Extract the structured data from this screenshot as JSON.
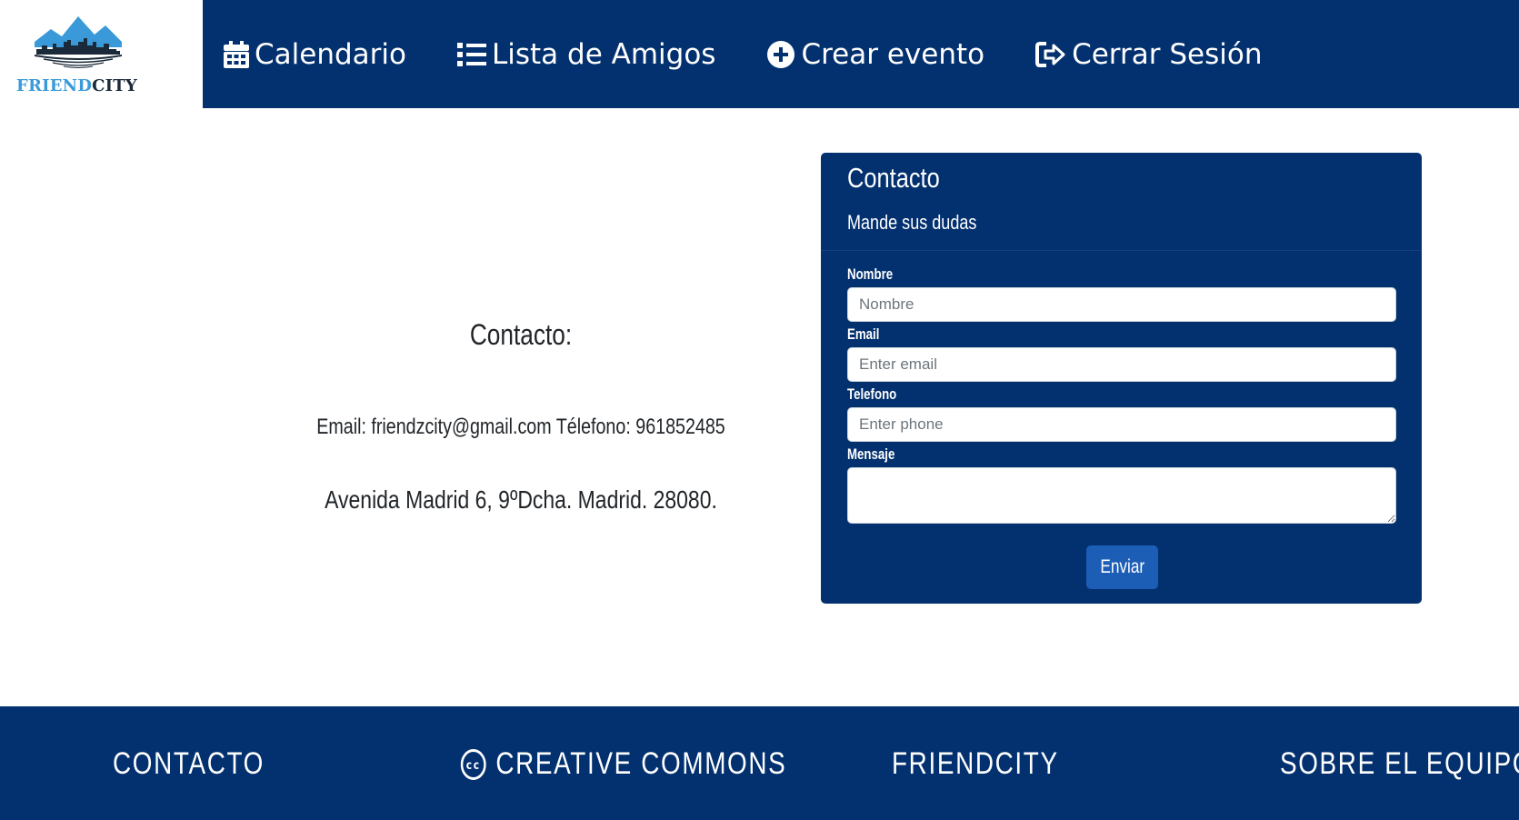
{
  "logo": {
    "part1": "FRIEND",
    "part2": "CITY"
  },
  "nav": [
    {
      "label": "Calendario",
      "icon": "calendar-icon"
    },
    {
      "label": "Lista de Amigos",
      "icon": "list-icon"
    },
    {
      "label": "Crear evento",
      "icon": "plus-circle-icon"
    },
    {
      "label": "Cerrar Sesión",
      "icon": "sign-out-icon"
    }
  ],
  "contact_info": {
    "title": "Contacto:",
    "email_phone": "Email: friendzcity@gmail.com Télefono: 961852485",
    "address": "Avenida Madrid 6, 9ºDcha. Madrid. 28080."
  },
  "form": {
    "title": "Contacto",
    "subtitle": "Mande sus dudas",
    "name_label": "Nombre",
    "name_placeholder": "Nombre",
    "email_label": "Email",
    "email_placeholder": "Enter email",
    "phone_label": "Telefono",
    "phone_placeholder": "Enter phone",
    "message_label": "Mensaje",
    "submit_label": "Enviar"
  },
  "footer": {
    "contacto": "CONTACTO",
    "creative_commons": "CREATIVE COMMONS",
    "friendcity": "FRIENDCITY",
    "sobre_equipo": "SOBRE EL EQUIPO"
  },
  "colors": {
    "primary": "#03316f",
    "button": "#1c5db6",
    "logo_blue": "#3a9ad9"
  }
}
